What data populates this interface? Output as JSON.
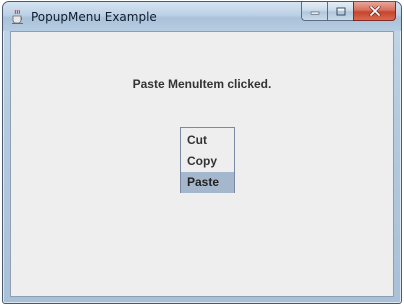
{
  "window": {
    "title": "PopupMenu Example",
    "controls": {
      "minimize": "minimize",
      "maximize": "maximize",
      "close": "close"
    }
  },
  "content": {
    "status_text": "Paste MenuItem clicked."
  },
  "popup_menu": {
    "items": [
      {
        "label": "Cut",
        "selected": false
      },
      {
        "label": "Copy",
        "selected": false
      },
      {
        "label": "Paste",
        "selected": true
      }
    ]
  },
  "colors": {
    "selection": "#a5b7cc",
    "background": "#eeeeee",
    "close_button": "#c7442e"
  },
  "icons": {
    "app": "java-coffee-cup-icon",
    "minimize": "minimize-icon",
    "maximize": "maximize-icon",
    "close": "close-icon"
  }
}
